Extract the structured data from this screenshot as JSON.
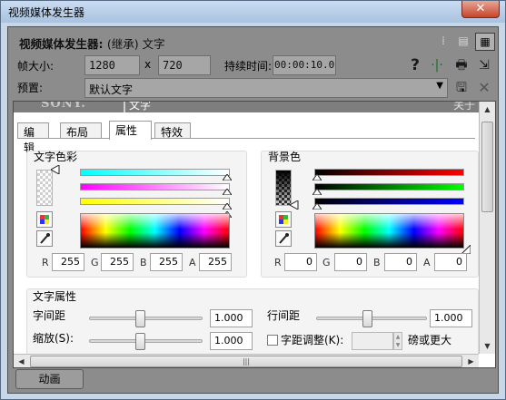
{
  "window": {
    "title": "视频媒体发生器",
    "close": "✕"
  },
  "header": {
    "title_bold": "视频媒体发生器:",
    "title_plain": "(继承) 文字"
  },
  "frame_size": {
    "label": "帧大小:",
    "width": "1280",
    "x": "x",
    "height": "720"
  },
  "duration": {
    "label": "持续时间:",
    "value": "00:00:10.00"
  },
  "preset": {
    "label": "预置:",
    "value": "默认文字"
  },
  "banner": {
    "brand": "SONY.",
    "name": "文字",
    "about": "关于"
  },
  "tabs": [
    "编辑",
    "布局",
    "属性",
    "特效"
  ],
  "active_tab": 2,
  "text_color": {
    "title": "文字色彩",
    "r_label": "R",
    "r": "255",
    "g_label": "G",
    "g": "255",
    "b_label": "B",
    "b": "255",
    "a_label": "A",
    "a": "255"
  },
  "bg_color": {
    "title": "背景色",
    "r_label": "R",
    "r": "0",
    "g_label": "G",
    "g": "0",
    "b_label": "B",
    "b": "0",
    "a_label": "A",
    "a": "0"
  },
  "text_props": {
    "title": "文字属性",
    "tracking_label": "字间距",
    "tracking": "1.000",
    "line_spacing_label": "行间距",
    "line_spacing": "1.000",
    "scale_label": "缩放(S):",
    "scale": "1.000",
    "kerning_label": "字距调整(K):",
    "kerning_suffix": "磅或更大"
  },
  "bottom": {
    "animate": "动画"
  },
  "colors": {
    "titlebar": "#b9cfe8",
    "panel_bg": "#8c8c8c",
    "close": "#c6452b"
  }
}
